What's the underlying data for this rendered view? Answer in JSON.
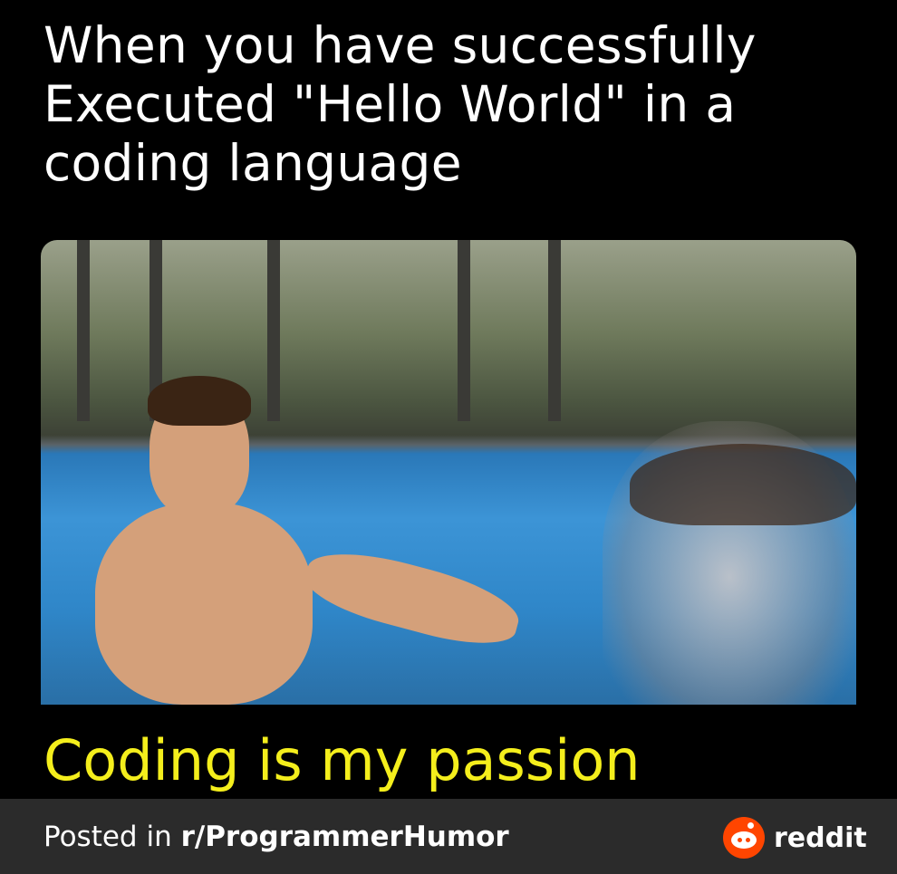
{
  "meme": {
    "top_text": "When you have successfully Executed \"Hello World\" in a coding language",
    "bottom_text": "Coding is my passion"
  },
  "footer": {
    "posted_prefix": "Posted in ",
    "subreddit": "r/ProgrammerHumor",
    "brand": "reddit"
  },
  "colors": {
    "caption": "#f4ee1c",
    "reddit_orange": "#ff4500",
    "footer_bg": "#2b2b2b"
  }
}
